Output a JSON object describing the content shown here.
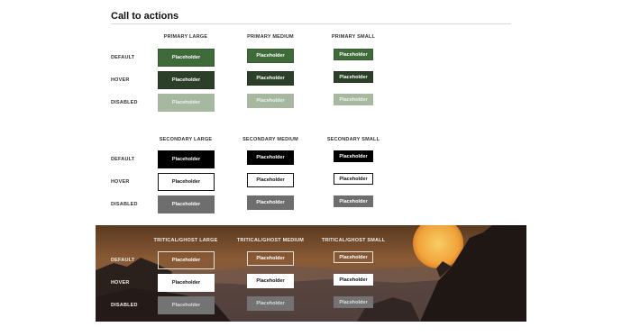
{
  "title": "Call to actions",
  "button_label": "Placeholder",
  "rows": {
    "default": "DEFAULT",
    "hover": "HOVER",
    "disabled": "DISABLED"
  },
  "primary": {
    "large": "PRIMARY LARGE",
    "medium": "PRIMARY MEDIUM",
    "small": "PRIMARY SMALL"
  },
  "secondary": {
    "large": "SECONDARY LARGE",
    "medium": "SECONDARY MEDIUM",
    "small": "SECONDARY SMALL"
  },
  "ghost": {
    "large": "TRITICAL/GHOST LARGE",
    "medium": "TRITICAL/GHOST MEDIUM",
    "small": "TRITICAL/GHOST SMALL"
  },
  "colors": {
    "primary": "#3f6b3b",
    "primary_hover": "#2c3f28",
    "primary_disabled": "#a6b9a0",
    "secondary": "#000000",
    "secondary_disabled": "#6e6e6e",
    "ghost_disabled": "#737373",
    "divider": "#cfdbe4"
  }
}
